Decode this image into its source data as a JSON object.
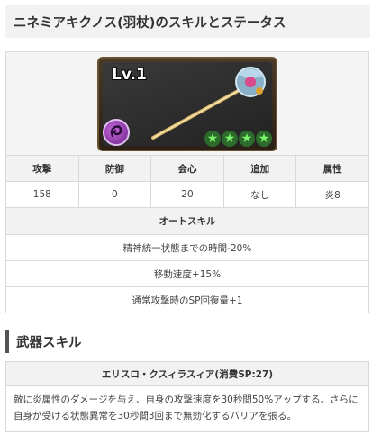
{
  "page_title": "ニネミアキクノス(羽杖)のスキルとステータス",
  "weapon_card": {
    "level_label": "Lv.1",
    "star_count": 4,
    "element_icon": "fire-swirl-icon"
  },
  "stats": {
    "headers": [
      "攻撃",
      "防御",
      "会心",
      "追加",
      "属性"
    ],
    "values": [
      "158",
      "0",
      "20",
      "なし",
      "炎8"
    ]
  },
  "auto_skill": {
    "header": "オートスキル",
    "items": [
      "精神統一状態までの時間-20%",
      "移動速度+15%",
      "通常攻撃時のSP回復量+1"
    ]
  },
  "weapon_skill": {
    "section_title": "武器スキル",
    "name": "エリスロ・クスィラスィア(消費SP:27)",
    "description": "敵に炎属性のダメージを与え、自身の攻撃速度を30秒間50%アップする。さらに自身が受ける状態異常を30秒間3回まで無効化するバリアを張る。"
  }
}
